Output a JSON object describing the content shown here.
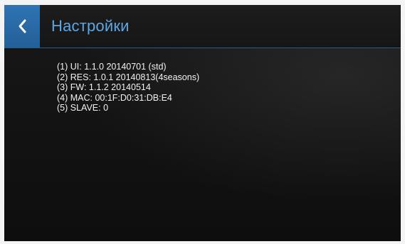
{
  "header": {
    "title": "Настройки",
    "back_icon": "chevron-left-icon",
    "accent_color": "#2f74b4",
    "title_color": "#5aa7e6"
  },
  "info": {
    "lines": [
      "(1) UI: 1.1.0 20140701 (std)",
      "(2) RES: 1.0.1 20140813(4seasons)",
      "(3) FW: 1.1.2 20140514",
      "(4) MAC: 00:1F:D0:31:DB:E4",
      "(5) SLAVE: 0"
    ]
  }
}
